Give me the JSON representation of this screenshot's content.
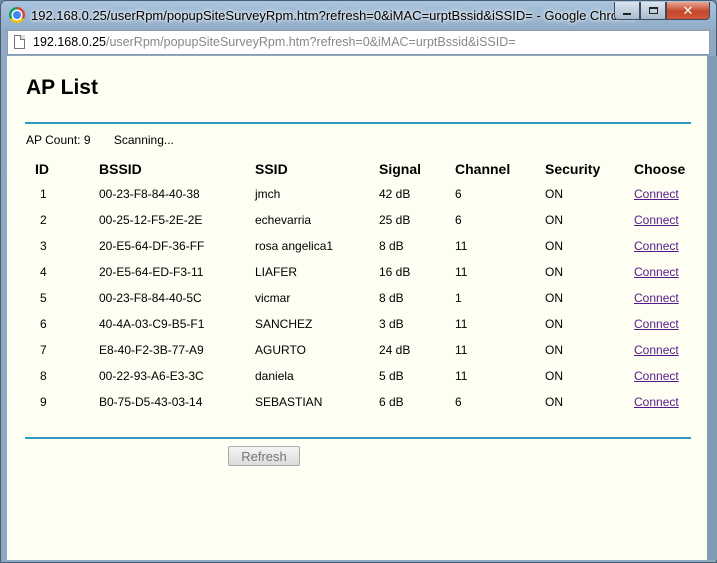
{
  "window": {
    "title": "192.168.0.25/userRpm/popupSiteSurveyRpm.htm?refresh=0&iMAC=urptBssid&iSSID= - Google Chrome",
    "close_glyph": "✕"
  },
  "address_bar": {
    "host": "192.168.0.25",
    "path": "/userRpm/popupSiteSurveyRpm.htm?refresh=0&iMAC=urptBssid&iSSID="
  },
  "page": {
    "title": "AP List",
    "ap_count_label": "AP Count: 9",
    "scanning_text": "Scanning...",
    "refresh_label": "Refresh"
  },
  "table": {
    "headers": {
      "id": "ID",
      "bssid": "BSSID",
      "ssid": "SSID",
      "signal": "Signal",
      "channel": "Channel",
      "security": "Security",
      "choose": "Choose"
    },
    "rows": [
      {
        "id": "1",
        "bssid": "00-23-F8-84-40-38",
        "ssid": "jmch",
        "signal": "42 dB",
        "channel": "6",
        "security": "ON",
        "action": "Connect"
      },
      {
        "id": "2",
        "bssid": "00-25-12-F5-2E-2E",
        "ssid": "echevarria",
        "signal": "25 dB",
        "channel": "6",
        "security": "ON",
        "action": "Connect"
      },
      {
        "id": "3",
        "bssid": "20-E5-64-DF-36-FF",
        "ssid": "rosa angelica1",
        "signal": "8 dB",
        "channel": "11",
        "security": "ON",
        "action": "Connect"
      },
      {
        "id": "4",
        "bssid": "20-E5-64-ED-F3-11",
        "ssid": "LIAFER",
        "signal": "16 dB",
        "channel": "11",
        "security": "ON",
        "action": "Connect"
      },
      {
        "id": "5",
        "bssid": "00-23-F8-84-40-5C",
        "ssid": "vicmar",
        "signal": "8 dB",
        "channel": "1",
        "security": "ON",
        "action": "Connect"
      },
      {
        "id": "6",
        "bssid": "40-4A-03-C9-B5-F1",
        "ssid": "SANCHEZ",
        "signal": "3 dB",
        "channel": "11",
        "security": "ON",
        "action": "Connect"
      },
      {
        "id": "7",
        "bssid": "E8-40-F2-3B-77-A9",
        "ssid": "AGURTO",
        "signal": "24 dB",
        "channel": "11",
        "security": "ON",
        "action": "Connect"
      },
      {
        "id": "8",
        "bssid": "00-22-93-A6-E3-3C",
        "ssid": "daniela",
        "signal": "5 dB",
        "channel": "11",
        "security": "ON",
        "action": "Connect"
      },
      {
        "id": "9",
        "bssid": "B0-75-D5-43-03-14",
        "ssid": "SEBASTIAN",
        "signal": "6 dB",
        "channel": "6",
        "security": "ON",
        "action": "Connect"
      }
    ]
  },
  "colors": {
    "page_background": "#fefef2",
    "rule": "#2d9ac3",
    "link": "#551a8b"
  }
}
